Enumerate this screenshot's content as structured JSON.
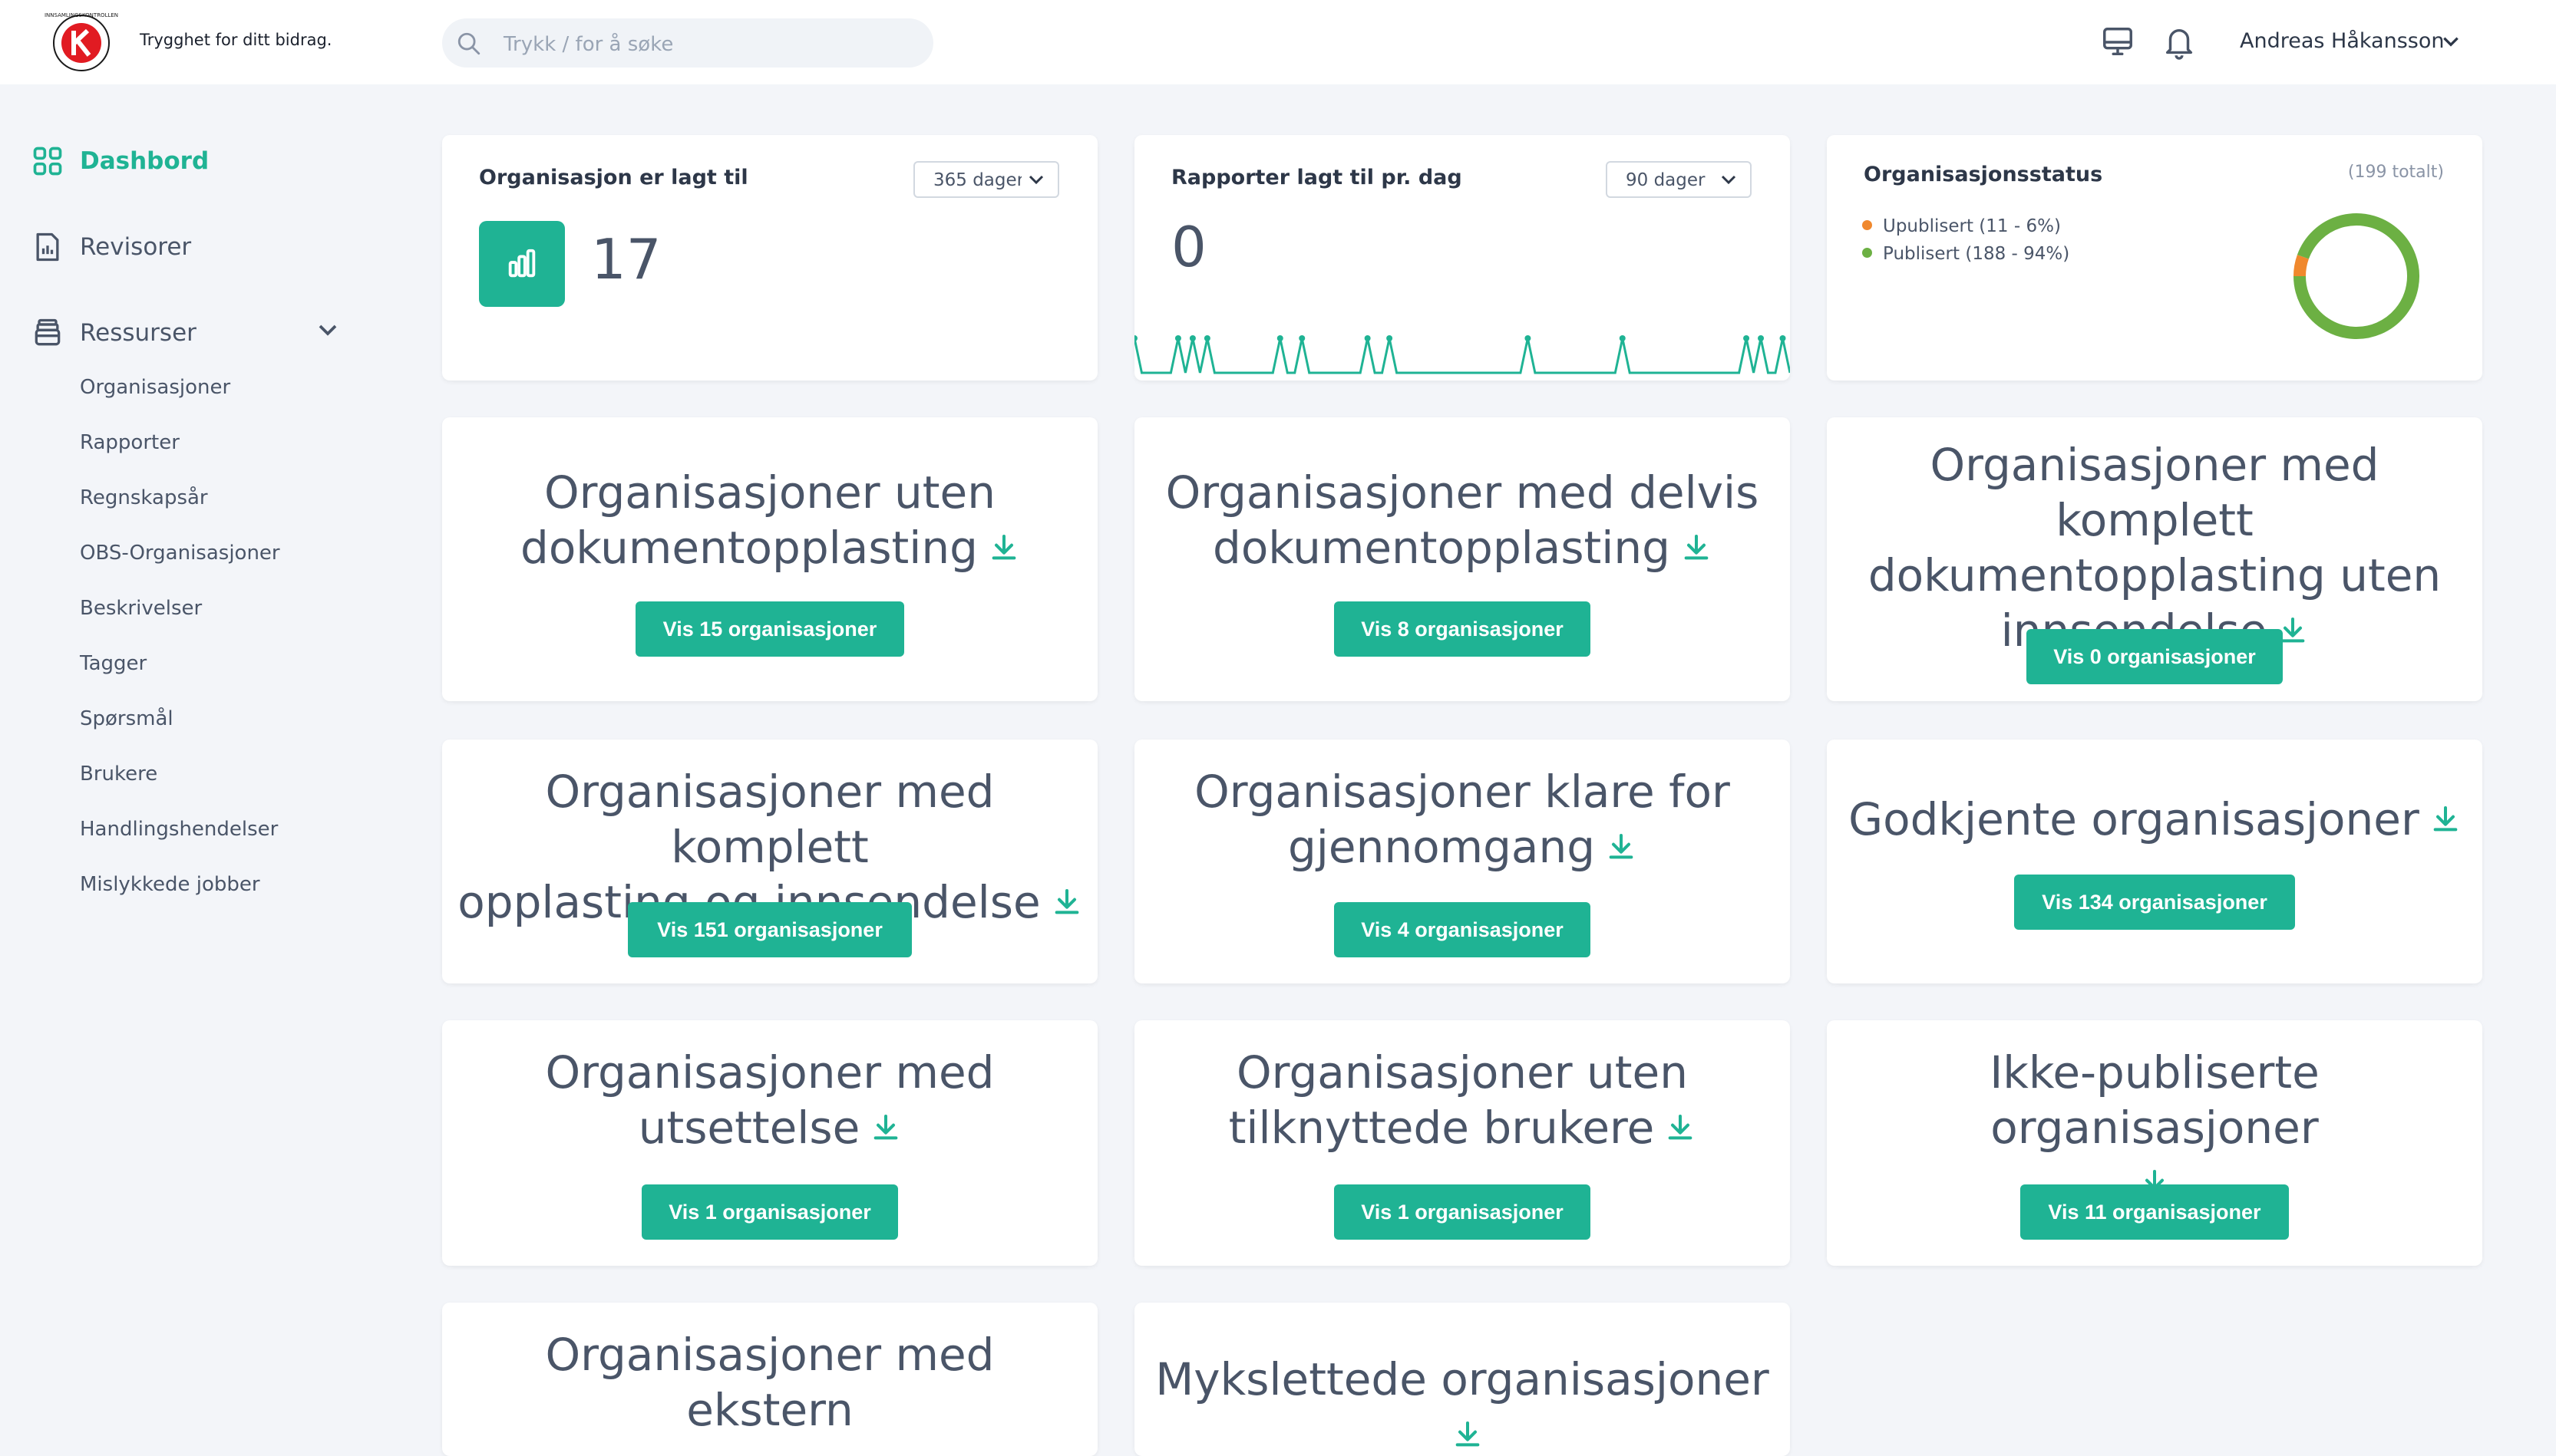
{
  "header": {
    "tagline": "Trygghet for ditt bidrag.",
    "logo_text": "INNSAMLINGSKONTROLLEN",
    "search_placeholder": "Trykk / for å søke",
    "user_name": "Andreas Håkansson"
  },
  "sidebar": {
    "dashboard": "Dashbord",
    "revisorer": "Revisorer",
    "ressurser": "Ressurser",
    "sub_items": [
      "Organisasjoner",
      "Rapporter",
      "Regnskapsår",
      "OBS-Organisasjoner",
      "Beskrivelser",
      "Tagger",
      "Spørsmål",
      "Brukere",
      "Handlingshendelser",
      "Mislykkede jobber"
    ]
  },
  "stats": {
    "org_added": {
      "title": "Organisasjon er lagt til",
      "select": "365 dager",
      "value": "17"
    },
    "reports_per_day": {
      "title": "Rapporter lagt til pr. dag",
      "select": "90 dager",
      "value": "0"
    },
    "org_status": {
      "title": "Organisasjonsstatus",
      "total": "(199 totalt)",
      "legend": [
        "Upublisert (11 - 6%)",
        "Publisert (188 - 94%)"
      ]
    }
  },
  "cards": [
    {
      "lines": [
        "Organisasjoner uten",
        "dokumentopplasting"
      ],
      "button": "Vis 15 organisasjoner"
    },
    {
      "lines": [
        "Organisasjoner med delvis",
        "dokumentopplasting"
      ],
      "button": "Vis 8 organisasjoner"
    },
    {
      "lines": [
        "Organisasjoner med komplett",
        "dokumentopplasting uten",
        "innsendelse"
      ],
      "button": "Vis 0 organisasjoner"
    },
    {
      "lines": [
        "Organisasjoner med komplett",
        "opplasting og innsendelse"
      ],
      "button": "Vis 151 organisasjoner"
    },
    {
      "lines": [
        "Organisasjoner klare for",
        "gjennomgang"
      ],
      "button": "Vis 4 organisasjoner"
    },
    {
      "lines": [
        "Godkjente organisasjoner"
      ],
      "button": "Vis 134 organisasjoner"
    },
    {
      "lines": [
        "Organisasjoner med",
        "utsettelse"
      ],
      "button": "Vis 1 organisasjoner"
    },
    {
      "lines": [
        "Organisasjoner uten",
        "tilknyttede brukere"
      ],
      "button": "Vis 1 organisasjoner"
    },
    {
      "lines": [
        "Ikke-publiserte organisasjoner"
      ],
      "button": "Vis 11 organisasjoner"
    },
    {
      "lines": [
        "Organisasjoner med ekstern"
      ],
      "button": ""
    },
    {
      "lines": [
        "Mykslettede organisasjoner"
      ],
      "button": ""
    }
  ],
  "colors": {
    "accent": "#1fb394",
    "unpublished": "#f0882d",
    "published": "#6cb043"
  },
  "chart_data": [
    {
      "type": "line",
      "title": "Rapporter lagt til pr. dag",
      "x_days": 90,
      "values": [
        1,
        0,
        0,
        0,
        0,
        0,
        1,
        0,
        1,
        0,
        1,
        0,
        0,
        0,
        0,
        0,
        0,
        0,
        0,
        0,
        1,
        0,
        0,
        1,
        0,
        0,
        0,
        0,
        0,
        0,
        0,
        0,
        1,
        0,
        0,
        1,
        0,
        0,
        0,
        0,
        0,
        0,
        0,
        0,
        0,
        0,
        0,
        0,
        0,
        0,
        0,
        0,
        0,
        0,
        1,
        0,
        0,
        0,
        0,
        0,
        0,
        0,
        0,
        0,
        0,
        0,
        0,
        1,
        0,
        0,
        0,
        0,
        0,
        0,
        0,
        0,
        0,
        0,
        0,
        0,
        0,
        0,
        0,
        0,
        1,
        0,
        1,
        0,
        0,
        1,
        0
      ],
      "ylim": [
        0,
        2
      ]
    },
    {
      "type": "pie",
      "title": "Organisasjonsstatus",
      "categories": [
        "Upublisert",
        "Publisert"
      ],
      "values": [
        11,
        188
      ]
    }
  ]
}
